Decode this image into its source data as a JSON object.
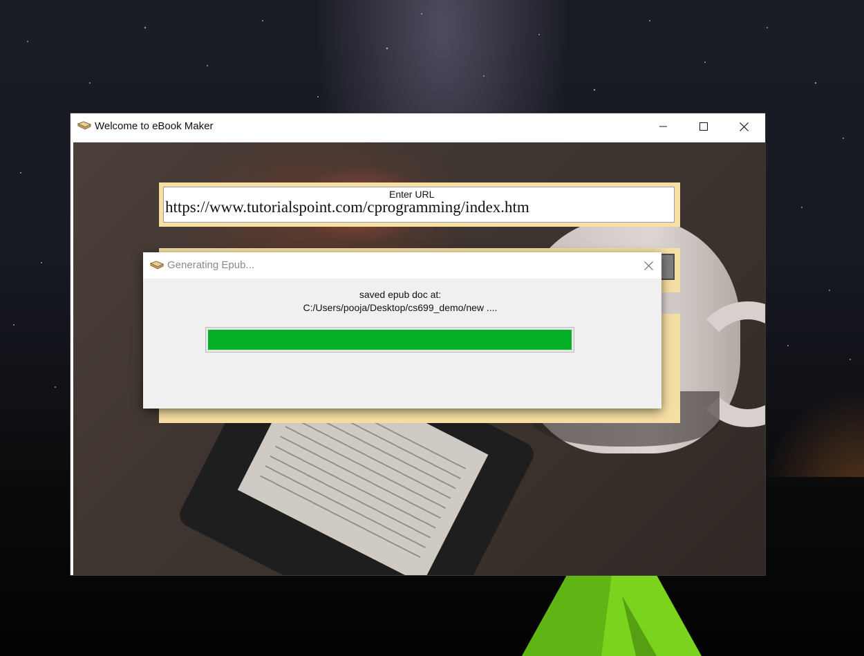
{
  "main_window": {
    "title": "Welcome to eBook Maker",
    "app_icon": "book-icon",
    "controls": {
      "minimize_icon": "minimize-icon",
      "maximize_icon": "maximize-icon",
      "close_icon": "close-icon"
    }
  },
  "form": {
    "url_label": "Enter URL",
    "url_value": "https://www.tutorialspoint.com/cprogramming/index.htm"
  },
  "dialog": {
    "title": "Generating Epub...",
    "icon": "book-icon",
    "close_icon": "close-icon",
    "message_line1": "saved epub doc at:",
    "message_line2": "C:/Users/pooja/Desktop/cs699_demo/new ....",
    "progress": 1.0,
    "progress_color": "#06b025"
  },
  "colors": {
    "panel_background": "#f6dfa4",
    "dialog_background": "#f0f0f0"
  }
}
